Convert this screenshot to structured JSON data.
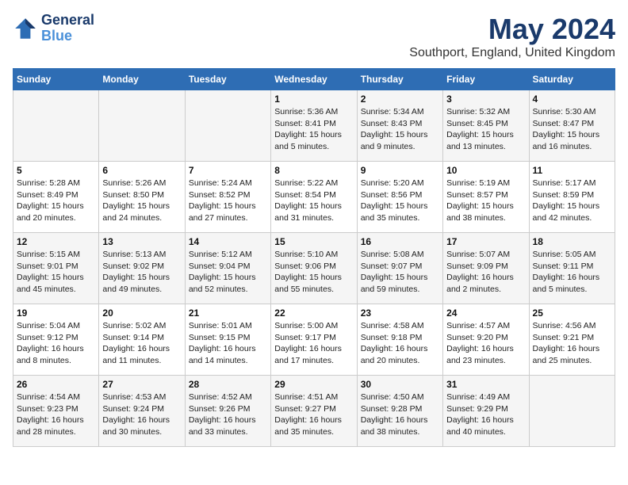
{
  "header": {
    "logo_line1": "General",
    "logo_line2": "Blue",
    "month": "May 2024",
    "location": "Southport, England, United Kingdom"
  },
  "weekdays": [
    "Sunday",
    "Monday",
    "Tuesday",
    "Wednesday",
    "Thursday",
    "Friday",
    "Saturday"
  ],
  "weeks": [
    [
      {
        "day": "",
        "info": ""
      },
      {
        "day": "",
        "info": ""
      },
      {
        "day": "",
        "info": ""
      },
      {
        "day": "1",
        "info": "Sunrise: 5:36 AM\nSunset: 8:41 PM\nDaylight: 15 hours\nand 5 minutes."
      },
      {
        "day": "2",
        "info": "Sunrise: 5:34 AM\nSunset: 8:43 PM\nDaylight: 15 hours\nand 9 minutes."
      },
      {
        "day": "3",
        "info": "Sunrise: 5:32 AM\nSunset: 8:45 PM\nDaylight: 15 hours\nand 13 minutes."
      },
      {
        "day": "4",
        "info": "Sunrise: 5:30 AM\nSunset: 8:47 PM\nDaylight: 15 hours\nand 16 minutes."
      }
    ],
    [
      {
        "day": "5",
        "info": "Sunrise: 5:28 AM\nSunset: 8:49 PM\nDaylight: 15 hours\nand 20 minutes."
      },
      {
        "day": "6",
        "info": "Sunrise: 5:26 AM\nSunset: 8:50 PM\nDaylight: 15 hours\nand 24 minutes."
      },
      {
        "day": "7",
        "info": "Sunrise: 5:24 AM\nSunset: 8:52 PM\nDaylight: 15 hours\nand 27 minutes."
      },
      {
        "day": "8",
        "info": "Sunrise: 5:22 AM\nSunset: 8:54 PM\nDaylight: 15 hours\nand 31 minutes."
      },
      {
        "day": "9",
        "info": "Sunrise: 5:20 AM\nSunset: 8:56 PM\nDaylight: 15 hours\nand 35 minutes."
      },
      {
        "day": "10",
        "info": "Sunrise: 5:19 AM\nSunset: 8:57 PM\nDaylight: 15 hours\nand 38 minutes."
      },
      {
        "day": "11",
        "info": "Sunrise: 5:17 AM\nSunset: 8:59 PM\nDaylight: 15 hours\nand 42 minutes."
      }
    ],
    [
      {
        "day": "12",
        "info": "Sunrise: 5:15 AM\nSunset: 9:01 PM\nDaylight: 15 hours\nand 45 minutes."
      },
      {
        "day": "13",
        "info": "Sunrise: 5:13 AM\nSunset: 9:02 PM\nDaylight: 15 hours\nand 49 minutes."
      },
      {
        "day": "14",
        "info": "Sunrise: 5:12 AM\nSunset: 9:04 PM\nDaylight: 15 hours\nand 52 minutes."
      },
      {
        "day": "15",
        "info": "Sunrise: 5:10 AM\nSunset: 9:06 PM\nDaylight: 15 hours\nand 55 minutes."
      },
      {
        "day": "16",
        "info": "Sunrise: 5:08 AM\nSunset: 9:07 PM\nDaylight: 15 hours\nand 59 minutes."
      },
      {
        "day": "17",
        "info": "Sunrise: 5:07 AM\nSunset: 9:09 PM\nDaylight: 16 hours\nand 2 minutes."
      },
      {
        "day": "18",
        "info": "Sunrise: 5:05 AM\nSunset: 9:11 PM\nDaylight: 16 hours\nand 5 minutes."
      }
    ],
    [
      {
        "day": "19",
        "info": "Sunrise: 5:04 AM\nSunset: 9:12 PM\nDaylight: 16 hours\nand 8 minutes."
      },
      {
        "day": "20",
        "info": "Sunrise: 5:02 AM\nSunset: 9:14 PM\nDaylight: 16 hours\nand 11 minutes."
      },
      {
        "day": "21",
        "info": "Sunrise: 5:01 AM\nSunset: 9:15 PM\nDaylight: 16 hours\nand 14 minutes."
      },
      {
        "day": "22",
        "info": "Sunrise: 5:00 AM\nSunset: 9:17 PM\nDaylight: 16 hours\nand 17 minutes."
      },
      {
        "day": "23",
        "info": "Sunrise: 4:58 AM\nSunset: 9:18 PM\nDaylight: 16 hours\nand 20 minutes."
      },
      {
        "day": "24",
        "info": "Sunrise: 4:57 AM\nSunset: 9:20 PM\nDaylight: 16 hours\nand 23 minutes."
      },
      {
        "day": "25",
        "info": "Sunrise: 4:56 AM\nSunset: 9:21 PM\nDaylight: 16 hours\nand 25 minutes."
      }
    ],
    [
      {
        "day": "26",
        "info": "Sunrise: 4:54 AM\nSunset: 9:23 PM\nDaylight: 16 hours\nand 28 minutes."
      },
      {
        "day": "27",
        "info": "Sunrise: 4:53 AM\nSunset: 9:24 PM\nDaylight: 16 hours\nand 30 minutes."
      },
      {
        "day": "28",
        "info": "Sunrise: 4:52 AM\nSunset: 9:26 PM\nDaylight: 16 hours\nand 33 minutes."
      },
      {
        "day": "29",
        "info": "Sunrise: 4:51 AM\nSunset: 9:27 PM\nDaylight: 16 hours\nand 35 minutes."
      },
      {
        "day": "30",
        "info": "Sunrise: 4:50 AM\nSunset: 9:28 PM\nDaylight: 16 hours\nand 38 minutes."
      },
      {
        "day": "31",
        "info": "Sunrise: 4:49 AM\nSunset: 9:29 PM\nDaylight: 16 hours\nand 40 minutes."
      },
      {
        "day": "",
        "info": ""
      }
    ]
  ]
}
